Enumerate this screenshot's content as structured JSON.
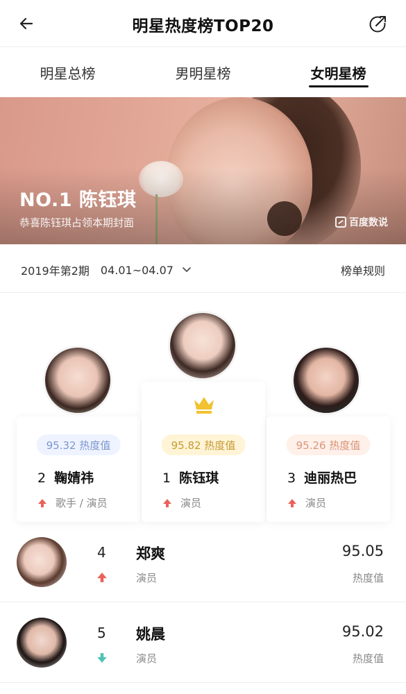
{
  "header": {
    "title": "明星热度榜TOP20"
  },
  "tabs": [
    {
      "label": "明星总榜",
      "active": false
    },
    {
      "label": "男明星榜",
      "active": false
    },
    {
      "label": "女明星榜",
      "active": true
    }
  ],
  "banner": {
    "headline": "NO.1 陈钰琪",
    "subtitle": "恭喜陈钰琪占领本期封面",
    "brand": "百度数说"
  },
  "period": {
    "issue": "2019年第2期",
    "dates": "04.01~04.07",
    "rules_label": "榜单规则"
  },
  "podium": [
    {
      "rank": "1",
      "name": "陈钰琪",
      "heat": "95.82 热度值",
      "tags": "演员",
      "trend": "up"
    },
    {
      "rank": "2",
      "name": "鞠婧祎",
      "heat": "95.32 热度值",
      "tags": "歌手 / 演员",
      "trend": "up"
    },
    {
      "rank": "3",
      "name": "迪丽热巴",
      "heat": "95.26 热度值",
      "tags": "演员",
      "trend": "up"
    }
  ],
  "list": [
    {
      "rank": "4",
      "name": "郑爽",
      "job": "演员",
      "score": "95.05",
      "unit": "热度值",
      "trend": "up"
    },
    {
      "rank": "5",
      "name": "姚晨",
      "job": "演员",
      "score": "95.02",
      "unit": "热度值",
      "trend": "down"
    }
  ],
  "colors": {
    "up": "#e9625a",
    "down": "#4fc3b3",
    "crown": "#f2c230"
  },
  "icons": {
    "back": "arrow-left-icon",
    "share": "share-icon",
    "crown": "crown-icon",
    "chevron": "chevron-down-icon"
  }
}
